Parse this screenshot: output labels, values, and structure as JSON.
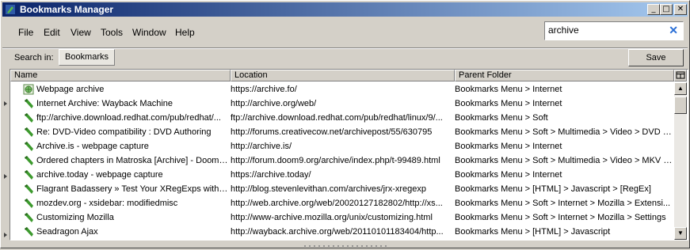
{
  "window": {
    "title": "Bookmarks Manager"
  },
  "menu": {
    "file": "File",
    "edit": "Edit",
    "view": "View",
    "tools": "Tools",
    "window": "Window",
    "help": "Help"
  },
  "search": {
    "value": "archive",
    "clear": "✕"
  },
  "scope": {
    "label": "Search in:",
    "button": "Bookmarks"
  },
  "save_label": "Save",
  "columns": {
    "name": "Name",
    "location": "Location",
    "parent": "Parent Folder"
  },
  "rows": [
    {
      "name": "Webpage archive",
      "location": "https://archive.fo/",
      "parent": "Bookmarks Menu > Internet",
      "icon": "archive-page-icon"
    },
    {
      "name": "Internet Archive: Wayback Machine",
      "location": "http://archive.org/web/",
      "parent": "Bookmarks Menu > Internet",
      "icon": "bookmark-icon"
    },
    {
      "name": "ftp://archive.download.redhat.com/pub/redhat/...",
      "location": "ftp://archive.download.redhat.com/pub/redhat/linux/9/...",
      "parent": "Bookmarks Menu > Soft",
      "icon": "bookmark-icon"
    },
    {
      "name": "Re: DVD-Video compatibility : DVD Authoring",
      "location": "http://forums.creativecow.net/archivepost/55/630795",
      "parent": "Bookmarks Menu > Soft > Multimedia > Video > DVD > ...",
      "icon": "bookmark-icon"
    },
    {
      "name": "Archive.is - webpage capture",
      "location": "http://archive.is/",
      "parent": "Bookmarks Menu > Internet",
      "icon": "bookmark-icon"
    },
    {
      "name": "Ordered chapters in Matroska [Archive] - Doom9...",
      "location": "http://forum.doom9.org/archive/index.php/t-99489.html",
      "parent": "Bookmarks Menu > Soft > Multimedia > Video > MKV > ...",
      "icon": "bookmark-icon"
    },
    {
      "name": "archive.today - webpage capture",
      "location": "https://archive.today/",
      "parent": "Bookmarks Menu > Internet",
      "icon": "bookmark-icon"
    },
    {
      "name": "Flagrant Badassery » Test Your XRegExps with J...",
      "location": "http://blog.stevenlevithan.com/archives/jrx-xregexp",
      "parent": "Bookmarks Menu > [HTML] > Javascript > [RegEx]",
      "icon": "bookmark-icon"
    },
    {
      "name": "mozdev.org - xsidebar: modifiedmisc",
      "location": "http://web.archive.org/web/20020127182802/http://xs...",
      "parent": "Bookmarks Menu > Soft > Internet > Mozilla > Extensi...",
      "icon": "bookmark-icon"
    },
    {
      "name": "Customizing Mozilla",
      "location": "http://www-archive.mozilla.org/unix/customizing.html",
      "parent": "Bookmarks Menu > Soft > Internet > Mozilla > Settings",
      "icon": "bookmark-icon"
    },
    {
      "name": "Seadragon Ajax",
      "location": "http://wayback.archive.org/web/20110101183404/http...",
      "parent": "Bookmarks Menu > [HTML] > Javascript",
      "icon": "bookmark-icon"
    }
  ],
  "colors": {
    "title_start": "#0a246a",
    "title_end": "#a6caf0",
    "bookmark_green": "#3d9a2e",
    "clear_blue": "#2a6fd6"
  }
}
